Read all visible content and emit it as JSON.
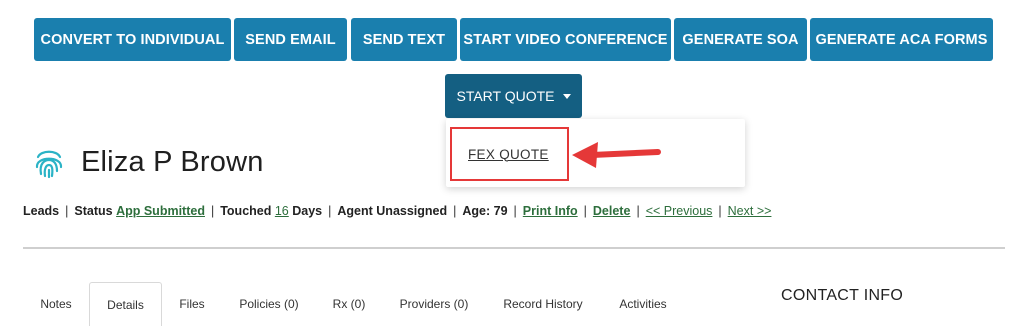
{
  "toolbar": {
    "buttons": [
      "CONVERT TO INDIVIDUAL",
      "SEND EMAIL",
      "SEND TEXT",
      "START VIDEO CONFERENCE",
      "GENERATE SOA",
      "GENERATE ACA FORMS"
    ]
  },
  "quote": {
    "button_label": "START QUOTE",
    "dropdown_item": "FEX QUOTE"
  },
  "lead": {
    "name": "Eliza P Brown"
  },
  "info": {
    "leads": "Leads",
    "status_label": "Status",
    "status_value": "App Submitted",
    "touched_label": "Touched",
    "touched_value": "16",
    "touched_unit": "Days",
    "agent": "Agent Unassigned",
    "age": "Age: 79",
    "print": "Print Info",
    "delete": "Delete",
    "previous": "<< Previous",
    "next": "Next >>"
  },
  "tabs": [
    "Notes",
    "Details",
    "Files",
    "Policies (0)",
    "Rx (0)",
    "Providers (0)",
    "Record History",
    "Activities"
  ],
  "active_tab": "Details",
  "contact": {
    "title": "CONTACT INFO"
  },
  "colors": {
    "primary_button": "#1a7fae",
    "quote_button": "#145f82",
    "highlight": "#e53838",
    "link_green": "#2d6e3c"
  }
}
